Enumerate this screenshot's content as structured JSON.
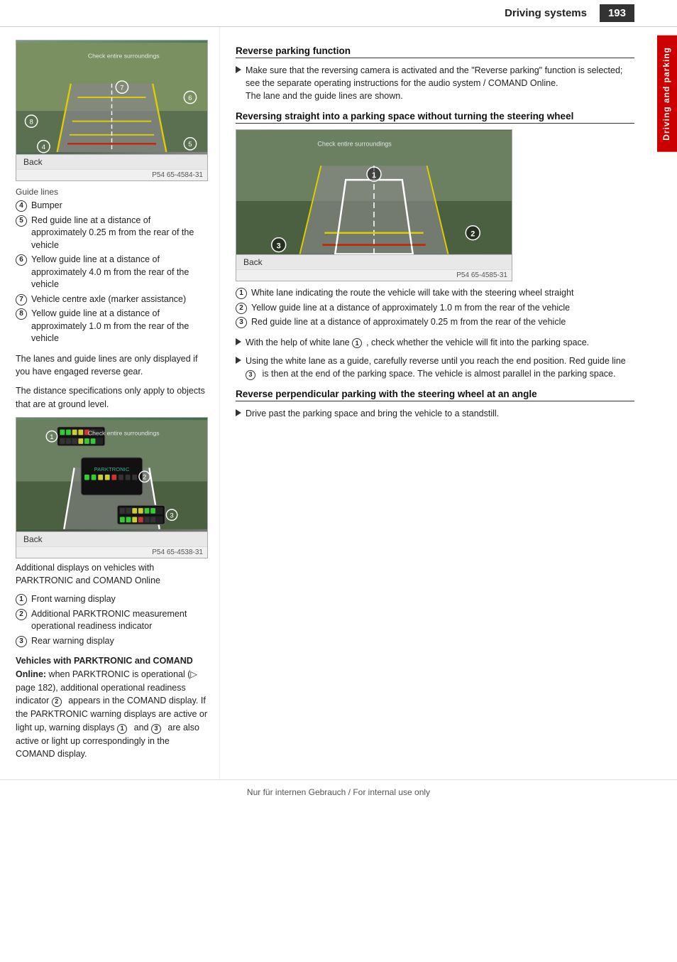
{
  "header": {
    "title": "Driving systems",
    "page_num": "193"
  },
  "side_tab": {
    "label": "Driving and parking"
  },
  "footer": {
    "text": "Nur für internen Gebrauch / For internal use only"
  },
  "left_col": {
    "image1": {
      "back_btn": "Back",
      "code": "P54 65-4584-31",
      "alt": "Reversing camera guide lines diagram"
    },
    "guide_lines_label": "Guide lines",
    "items": [
      {
        "num": "④",
        "text": "Bumper"
      },
      {
        "num": "⑤",
        "text": "Red guide line at a distance of approximately 0.25 m from the rear of the vehicle"
      },
      {
        "num": "⑥",
        "text": "Yellow guide line at a distance of approximately 4.0 m from the rear of the vehicle"
      },
      {
        "num": "⑦",
        "text": "Vehicle centre axle (marker assistance)"
      },
      {
        "num": "⑧",
        "text": "Yellow guide line at a distance of approximately 1.0 m from the rear of the vehicle"
      }
    ],
    "para1": "The lanes and guide lines are only displayed if you have engaged reverse gear.",
    "para2": "The distance specifications only apply to objects that are at ground level.",
    "image2": {
      "back_btn": "Back",
      "code": "P54 65-4538-31",
      "alt": "Additional displays PARKTRONIC COMAND diagram"
    },
    "add_displays_label": "Additional displays on vehicles with PARKTRONIC and COMAND Online",
    "items2": [
      {
        "num": "①",
        "text": "Front warning display"
      },
      {
        "num": "②",
        "text": "Additional PARKTRONIC measurement operational readiness indicator"
      },
      {
        "num": "③",
        "text": "Rear warning display"
      }
    ],
    "vehicles_heading": "Vehicles with PARKTRONIC and COMAND Online:",
    "vehicles_text": "when PARKTRONIC is operational (▷ page 182), additional operational readiness indicator ② appears in the COMAND display. If the PARKTRONIC warning displays are active or light up, warning displays ① and ③ are also active or light up correspondingly in the COMAND display."
  },
  "right_col": {
    "reverse_parking_heading": "Reverse parking function",
    "reverse_parking_bullet": "Make sure that the reversing camera is activated and the \"Reverse parking\" function is selected; see the separate operating instructions for the audio system / COMAND Online.\nThe lane and the guide lines are shown.",
    "straight_heading": "Reversing straight into a parking space without turning the steering wheel",
    "image3": {
      "back_btn": "Back",
      "code": "P54 65-4585-31",
      "alt": "Reversing straight into parking space diagram"
    },
    "straight_items": [
      {
        "num": "①",
        "text": "White lane indicating the route the vehicle will take with the steering wheel straight"
      },
      {
        "num": "②",
        "text": "Yellow guide line at a distance of approximately 1.0 m from the rear of the vehicle"
      },
      {
        "num": "③",
        "text": "Red guide line at a distance of approximately 0.25 m from the rear of the vehicle"
      }
    ],
    "bullet1": "With the help of white lane ①, check whether the vehicle will fit into the parking space.",
    "bullet2": "Using the white lane as a guide, carefully reverse until you reach the end position. Red guide line ③ is then at the end of the parking space. The vehicle is almost parallel in the parking space.",
    "perp_heading": "Reverse perpendicular parking with the steering wheel at an angle",
    "perp_bullet": "Drive past the parking space and bring the vehicle to a standstill."
  }
}
